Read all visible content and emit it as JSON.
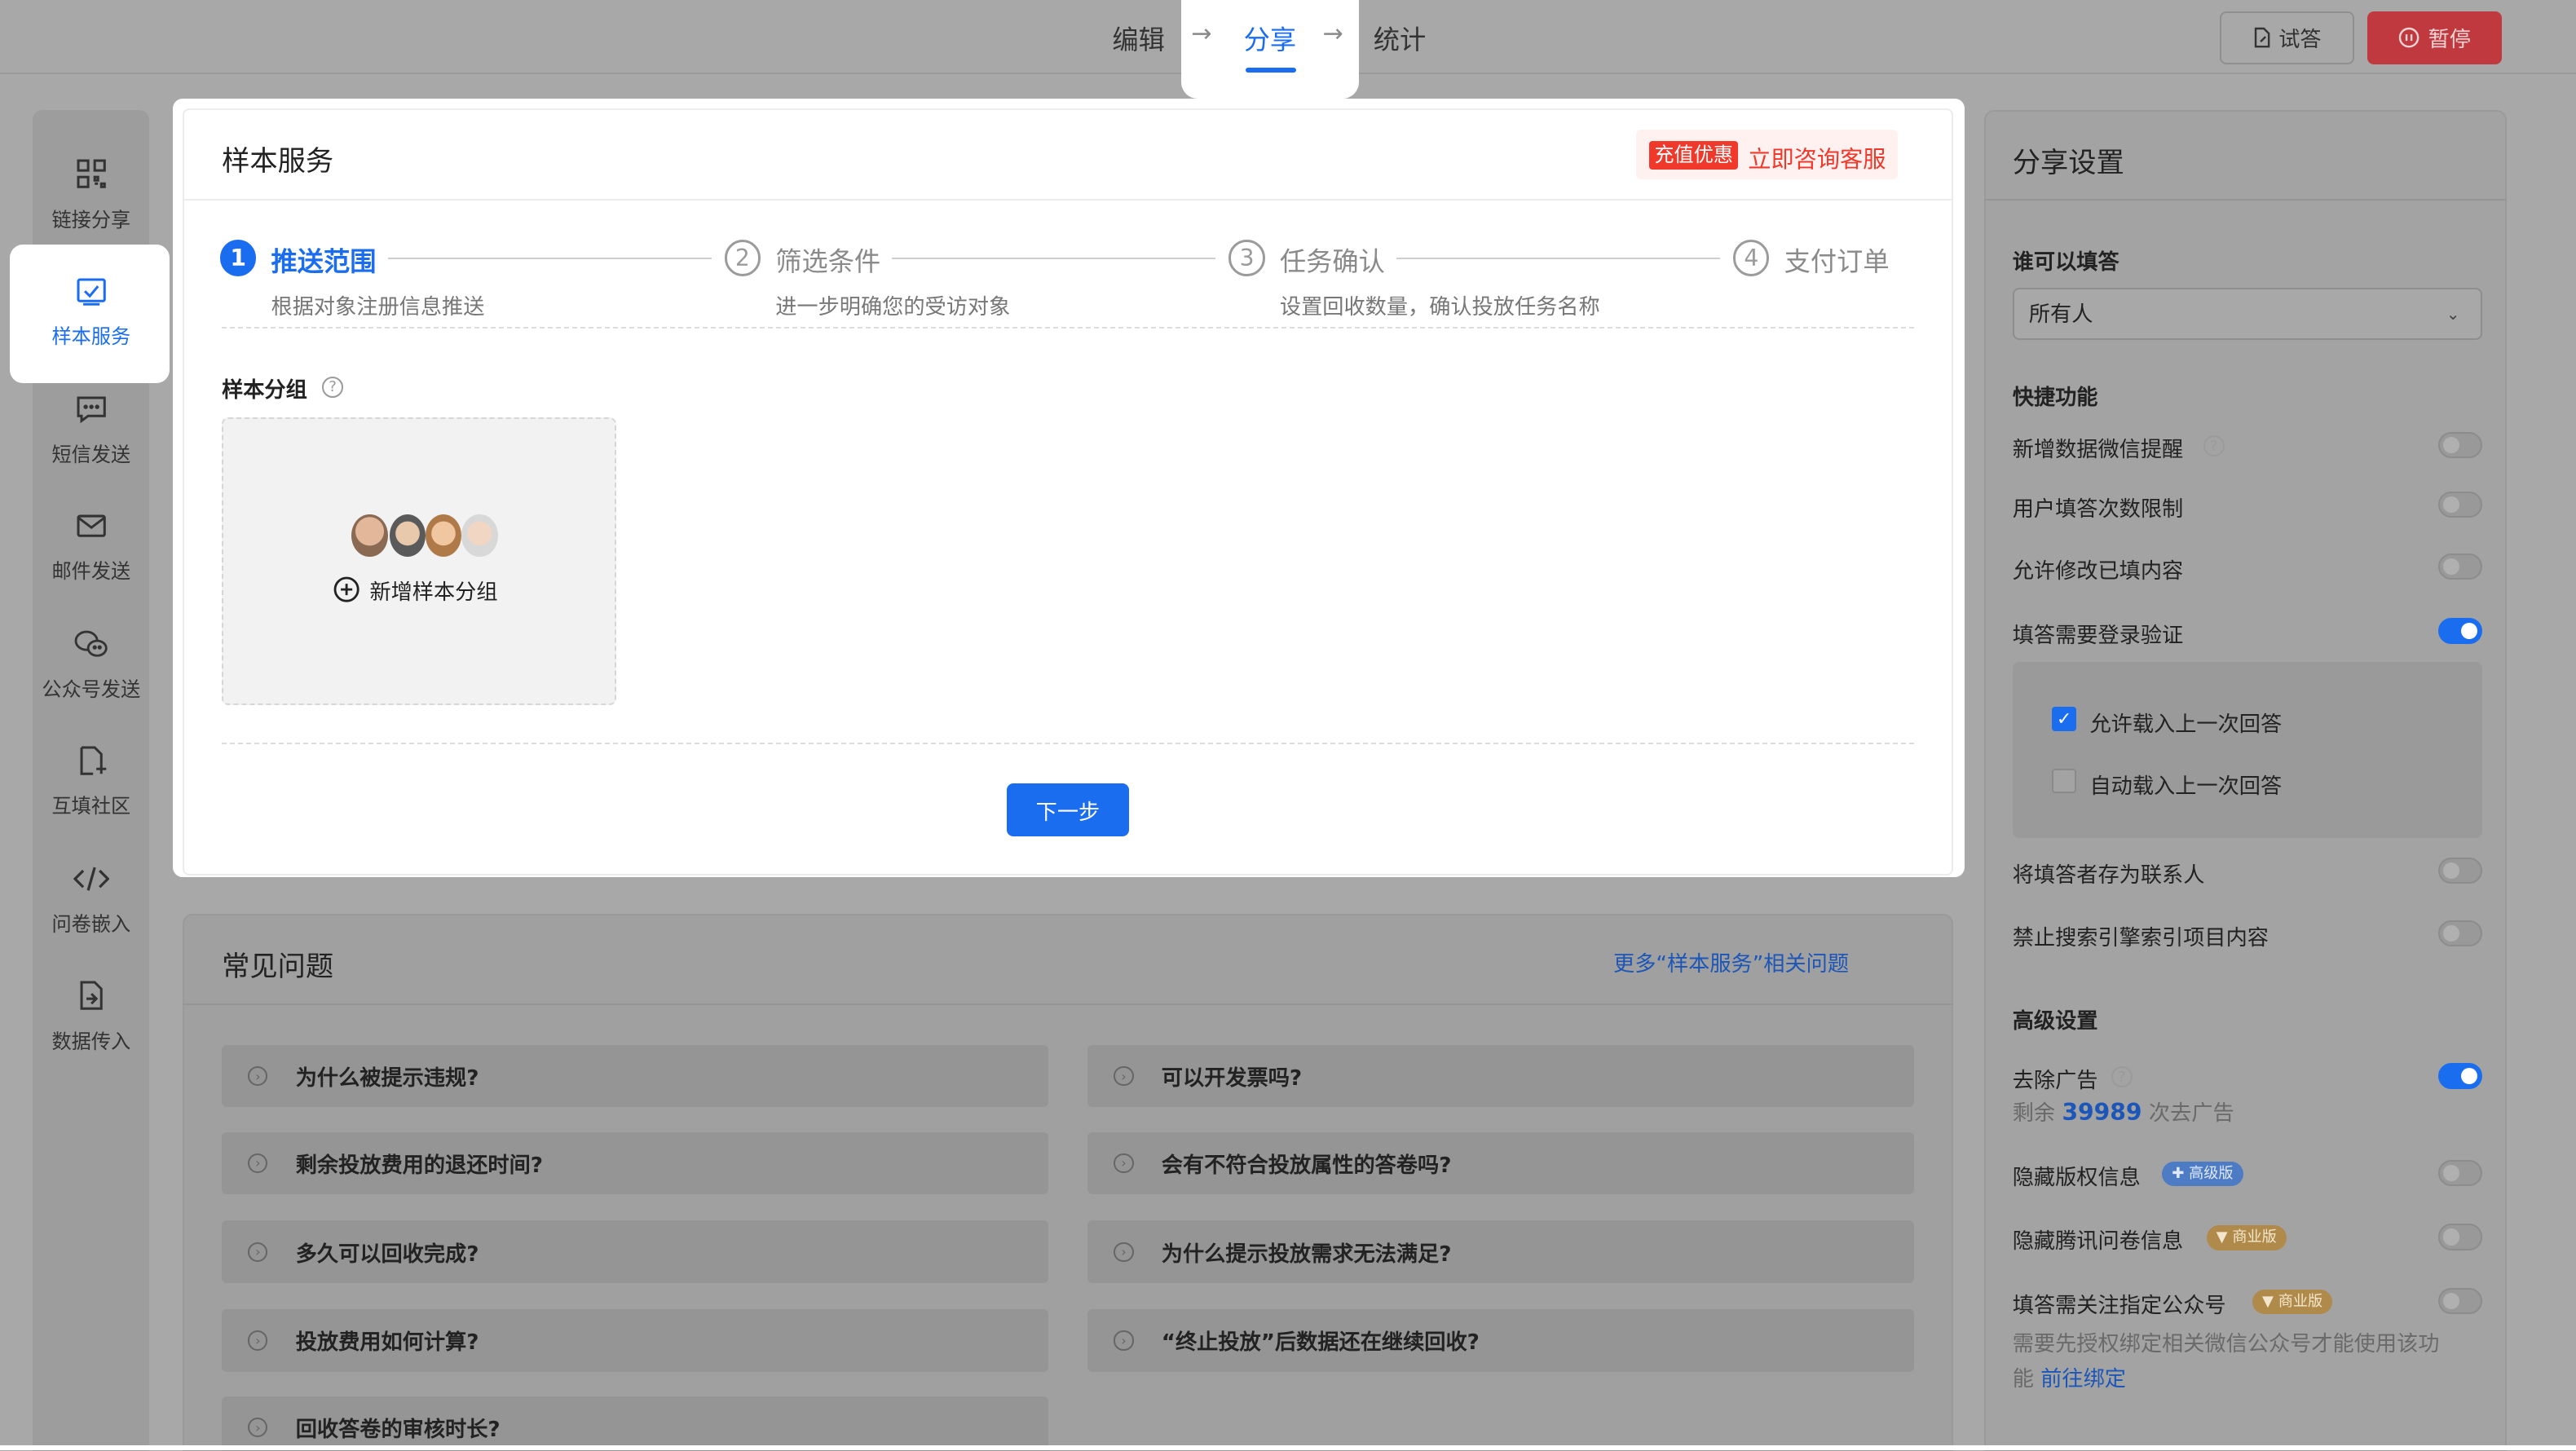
{
  "topbar": {
    "tabs": [
      "编辑",
      "分享",
      "统计"
    ],
    "active_tab": "分享",
    "try_label": "试答",
    "pause_label": "暂停"
  },
  "sidebar": {
    "items": [
      {
        "label": "链接分享",
        "icon": "qrcode-icon"
      },
      {
        "label": "样本服务",
        "icon": "checkbox-icon",
        "active": true
      },
      {
        "label": "短信发送",
        "icon": "sms-icon"
      },
      {
        "label": "邮件发送",
        "icon": "mail-icon"
      },
      {
        "label": "公众号发送",
        "icon": "wechat-icon"
      },
      {
        "label": "互填社区",
        "icon": "community-icon"
      },
      {
        "label": "问卷嵌入",
        "icon": "code-icon"
      },
      {
        "label": "数据传入",
        "icon": "import-icon"
      }
    ]
  },
  "sample_service": {
    "title": "样本服务",
    "promo_badge": "充值优惠",
    "promo_link": "立即咨询客服",
    "steps": [
      {
        "num": "1",
        "title": "推送范围",
        "desc": "根据对象注册信息推送"
      },
      {
        "num": "2",
        "title": "筛选条件",
        "desc": "进一步明确您的受访对象"
      },
      {
        "num": "3",
        "title": "任务确认",
        "desc": "设置回收数量，确认投放任务名称"
      },
      {
        "num": "4",
        "title": "支付订单",
        "desc": ""
      }
    ],
    "group_label": "样本分组",
    "add_group": "新增样本分组",
    "next_button": "下一步"
  },
  "faq": {
    "title": "常见问题",
    "more_link": "更多“样本服务”相关问题",
    "items": [
      "为什么被提示违规?",
      "可以开发票吗?",
      "剩余投放费用的退还时间?",
      "会有不符合投放属性的答卷吗?",
      "多久可以回收完成?",
      "为什么提示投放需求无法满足?",
      "投放费用如何计算?",
      "“终止投放”后数据还在继续回收?",
      "回收答卷的审核时长?"
    ]
  },
  "share_settings": {
    "title": "分享设置",
    "who_label": "谁可以填答",
    "who_value": "所有人",
    "quick_label": "快捷功能",
    "quick": [
      {
        "label": "新增数据微信提醒",
        "on": false
      },
      {
        "label": "用户填答次数限制",
        "on": false
      },
      {
        "label": "允许修改已填内容",
        "on": false
      },
      {
        "label": "填答需要登录验证",
        "on": true
      }
    ],
    "sub_options": [
      {
        "label": "允许载入上一次回答",
        "checked": true
      },
      {
        "label": "自动载入上一次回答",
        "checked": false
      }
    ],
    "quick2": [
      {
        "label": "将填答者存为联系人",
        "on": false
      },
      {
        "label": "禁止搜索引擎索引项目内容",
        "on": false
      }
    ],
    "advanced_label": "高级设置",
    "remove_ads": "去除广告",
    "ads_prefix": "剩余",
    "ads_count": "39989",
    "ads_suffix": "次去广告",
    "hide_copyright": "隐藏版权信息",
    "badge_pro": "✚ 高级版",
    "hide_tencent": "隐藏腾讯问卷信息",
    "badge_biz": "▼ 商业版",
    "follow_account": "填答需关注指定公众号",
    "follow_note": "需要先授权绑定相关微信公众号才能使用该功能",
    "follow_link": "前往绑定"
  },
  "colors": {
    "accent": "#1b6df0",
    "danger": "#c0393e",
    "promo": "#f0382b"
  }
}
